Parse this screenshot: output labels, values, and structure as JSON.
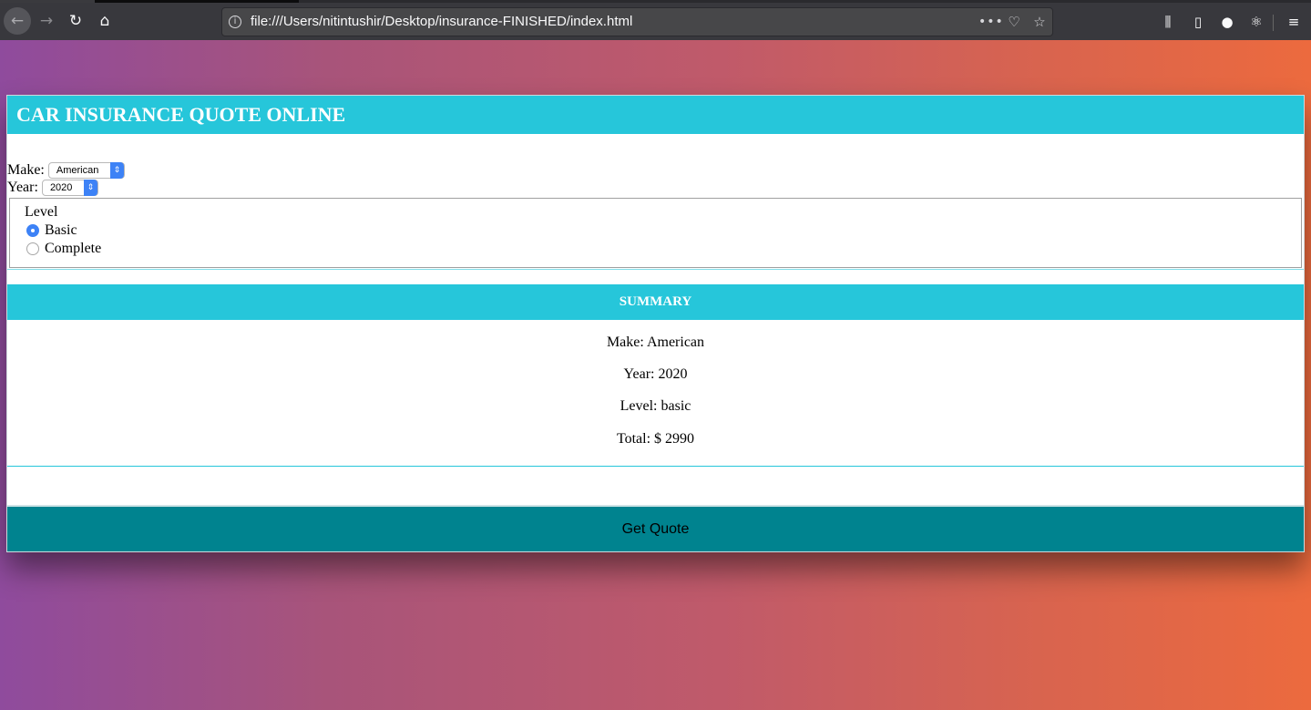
{
  "browser": {
    "url": "file:///Users/nitintushir/Desktop/insurance-FINISHED/index.html",
    "icons": [
      "back-icon",
      "forward-icon",
      "reload-icon",
      "home-icon",
      "info-icon",
      "more-icon",
      "pocket-icon",
      "star-icon",
      "library-icon",
      "sidebar-icon",
      "account-icon",
      "react-devtools-icon",
      "menu-icon"
    ]
  },
  "app": {
    "title": "CAR INSURANCE QUOTE ONLINE",
    "make_label": "Make:",
    "make_value": "American",
    "year_label": "Year:",
    "year_value": "2020",
    "level_legend": "Level",
    "level_options": [
      {
        "label": "Basic",
        "checked": true
      },
      {
        "label": "Complete",
        "checked": false
      }
    ],
    "summary_title": "SUMMARY",
    "summary": {
      "make": "Make: American",
      "year": "Year: 2020",
      "level": "Level: basic",
      "total": "Total: $ 2990"
    },
    "button_label": "Get Quote"
  },
  "colors": {
    "accent": "#26c6da",
    "button": "#00838f",
    "radio_selected": "#3d82f6"
  }
}
